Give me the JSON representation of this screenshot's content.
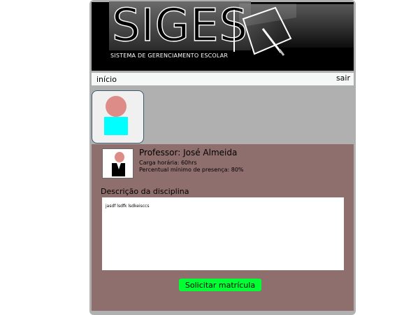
{
  "header": {
    "brand": "SIGES",
    "subtitle": "SISTEMA DE GERENCIAMENTO ESCOLAR",
    "logo_icon": "blackboard-pointer-icon"
  },
  "nav": {
    "home_label": "início",
    "logout_label": "sair"
  },
  "user": {
    "avatar_icon": "user-avatar-icon"
  },
  "teacher": {
    "name_line": "Professor: José Almeida",
    "workload_line": "Carga horária: 60hrs",
    "attendance_line": "Percentual mínimo de presença: 80%",
    "photo_icon": "teacher-avatar-icon"
  },
  "discipline": {
    "description_label": "Descrição da disciplina",
    "description_text": "jasdf lsdfk lsdkeisccs"
  },
  "actions": {
    "enroll_label": "Solicitar matrícula"
  },
  "colors": {
    "frame": "#b0b0b0",
    "content_bg": "#8f6f6d",
    "button": "#00ff33",
    "avatar_body": "#00ffff",
    "avatar_head": "#de8c88"
  }
}
